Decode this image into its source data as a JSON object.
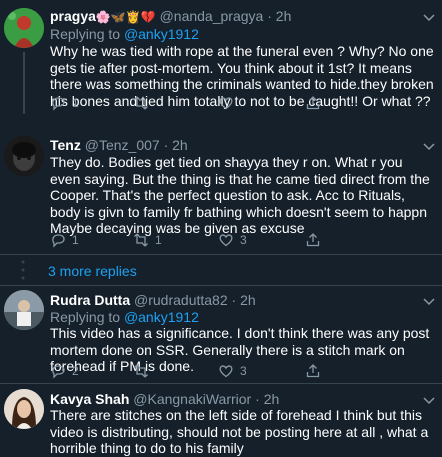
{
  "tweets": [
    {
      "name": "pragya",
      "name_emoji": "🌸🦋👸💔",
      "handle": "@nanda_pragya",
      "dot": "·",
      "time": "2h",
      "replying_to_prefix": "Replying to ",
      "replying_to": "@anky1912",
      "text": "Why he was tied with rope at the funeral even ? Why? No one gets tie after post-mortem. You think about it 1st? It means there was something the criminals wanted to hide.they broken his bones and tied him totally to not to be caught!! Or what ??",
      "reply_count": "1",
      "retweet_count": "",
      "like_count": ""
    },
    {
      "name": "Tenz",
      "handle": "@Tenz_007",
      "dot": "·",
      "time": "2h",
      "text_lines": [
        "They do. Bodies get tied on shayya they r on. What r you even saying. But the thing is that he came tied direct from the Cooper. That's the perfect question to ask. Acc to Rituals, body is givn to family fr bathing which doesn't seem to happn",
        "Maybe decaying was be given as excuse"
      ],
      "reply_count": "1",
      "retweet_count": "1",
      "like_count": "3"
    },
    {
      "name": "Rudra Dutta",
      "handle": "@rudradutta82",
      "dot": "·",
      "time": "2h",
      "replying_to_prefix": "Replying to ",
      "replying_to": "@anky1912",
      "text": "This video has a significance. I don't think there was any post mortem done on SSR. Generally there is a stitch mark on forehead if PM is done.",
      "reply_count": "2",
      "retweet_count": "",
      "like_count": "3"
    },
    {
      "name": "Kavya Shah",
      "handle": "@KangnakiWarrior",
      "dot": "·",
      "time": "2h",
      "text": "There are stitches on the left side of forehead I think but this video is distributing, should not be posting here at all , what a horrible thing to do to his family"
    }
  ],
  "more_replies": "3 more replies",
  "colors": {
    "background": "#15202b",
    "text": "#ffffff",
    "muted": "#8899a6",
    "accent": "#1da1f2",
    "divider": "#38444d"
  }
}
